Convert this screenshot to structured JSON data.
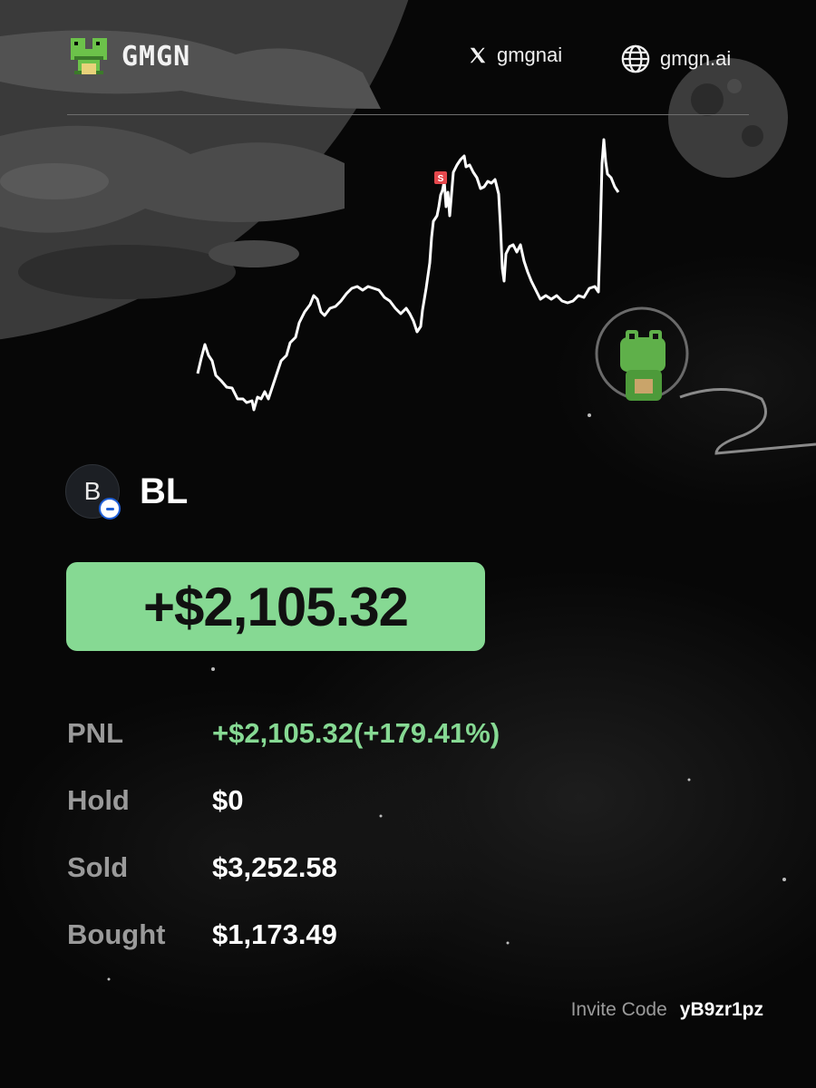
{
  "brand": {
    "name": "GMGN",
    "logo_icon": "frog-icon"
  },
  "social": {
    "x_handle": "gmgnai",
    "x_icon": "x-logo-icon",
    "website": "gmgn.ai",
    "website_icon": "globe-icon"
  },
  "chart": {
    "type": "line",
    "line_color": "#ffffff",
    "marker_label": "S",
    "marker_color": "#e5484d"
  },
  "token": {
    "avatar_letter": "B",
    "symbol": "BL",
    "chain_badge_icon": "solana-chain-icon"
  },
  "pnl_headline": "+$2,105.32",
  "stats": [
    {
      "label": "PNL",
      "value": "+$2,105.32(+179.41%)",
      "positive": true
    },
    {
      "label": "Hold",
      "value": "$0",
      "positive": false
    },
    {
      "label": "Sold",
      "value": "$3,252.58",
      "positive": false
    },
    {
      "label": "Bought",
      "value": "$1,173.49",
      "positive": false
    }
  ],
  "invite": {
    "label": "Invite Code",
    "code": "yB9zr1pz"
  },
  "colors": {
    "accent_green": "#86d993",
    "background": "#070707",
    "muted_text": "#9a9a9a"
  }
}
